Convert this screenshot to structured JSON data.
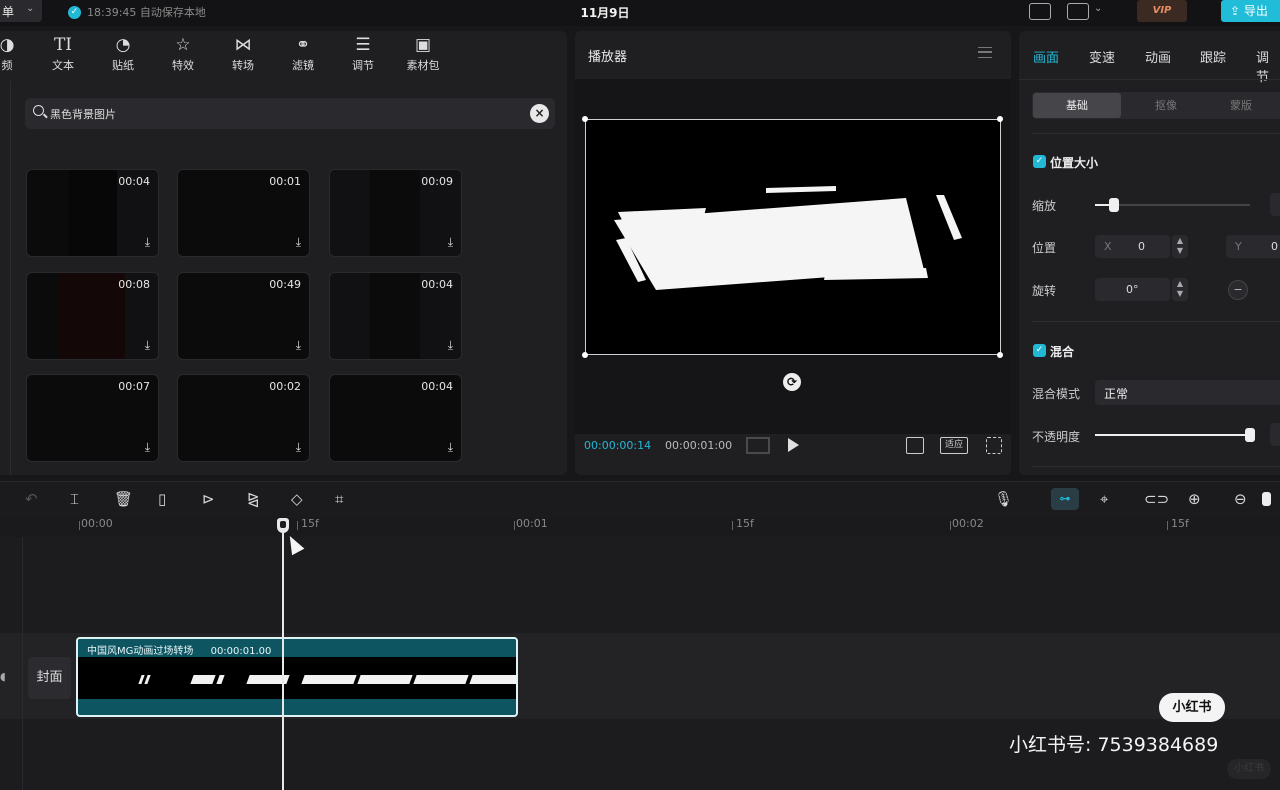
{
  "topbar": {
    "menu_label": "单",
    "save_status": "18:39:45 自动保存本地",
    "project_title": "11月9日",
    "vip_label": "VIP",
    "export_label": "导出"
  },
  "media": {
    "tools": [
      {
        "icon": "media-icon",
        "label": "频"
      },
      {
        "icon": "text-icon",
        "label": "文本"
      },
      {
        "icon": "sticker-icon",
        "label": "贴纸"
      },
      {
        "icon": "effects-icon",
        "label": "特效"
      },
      {
        "icon": "transition-icon",
        "label": "转场"
      },
      {
        "icon": "filter-icon",
        "label": "滤镜"
      },
      {
        "icon": "adjust-icon",
        "label": "调节"
      },
      {
        "icon": "asset-pack-icon",
        "label": "素材包"
      }
    ],
    "search": {
      "value": "黑色背景图片"
    },
    "thumbnails": [
      {
        "duration": "00:04"
      },
      {
        "duration": "00:01"
      },
      {
        "duration": "00:09"
      },
      {
        "duration": "00:08"
      },
      {
        "duration": "00:49"
      },
      {
        "duration": "00:04"
      },
      {
        "duration": "00:07"
      },
      {
        "duration": "00:02"
      },
      {
        "duration": "00:04"
      }
    ]
  },
  "player": {
    "title": "播放器",
    "time_current": "00:00:00:14",
    "time_total": "00:00:01:00",
    "ratio_label": "适应"
  },
  "properties": {
    "tabs": [
      "画面",
      "变速",
      "动画",
      "跟踪",
      "调节"
    ],
    "active_tab": "画面",
    "sub_tabs": [
      "基础",
      "抠像",
      "蒙版"
    ],
    "section_position": "位置大小",
    "scale_label": "缩放",
    "scale_level": 0.12,
    "position_label": "位置",
    "pos_x_prefix": "X",
    "pos_x": "0",
    "pos_y_prefix": "Y",
    "pos_y": "0",
    "rotate_label": "旋转",
    "rotate_value": "0°",
    "section_blend": "混合",
    "blend_mode_label": "混合模式",
    "blend_mode_value": "正常",
    "opacity_label": "不透明度",
    "opacity_level": 1.0
  },
  "timeline": {
    "ruler": [
      "00:00",
      "15f",
      "00:01",
      "15f",
      "00:02",
      "15f"
    ],
    "cover_label": "封面",
    "clip_name": "中国风MG动画过场转场",
    "clip_duration": "00:00:01.00"
  },
  "watermark": {
    "badge": "小红书",
    "text": "小红书号: 7539384689",
    "faint": "小红书"
  },
  "colors": {
    "accent": "#22b8d4",
    "vip": "#e78b62",
    "clip": "#0e5562"
  }
}
